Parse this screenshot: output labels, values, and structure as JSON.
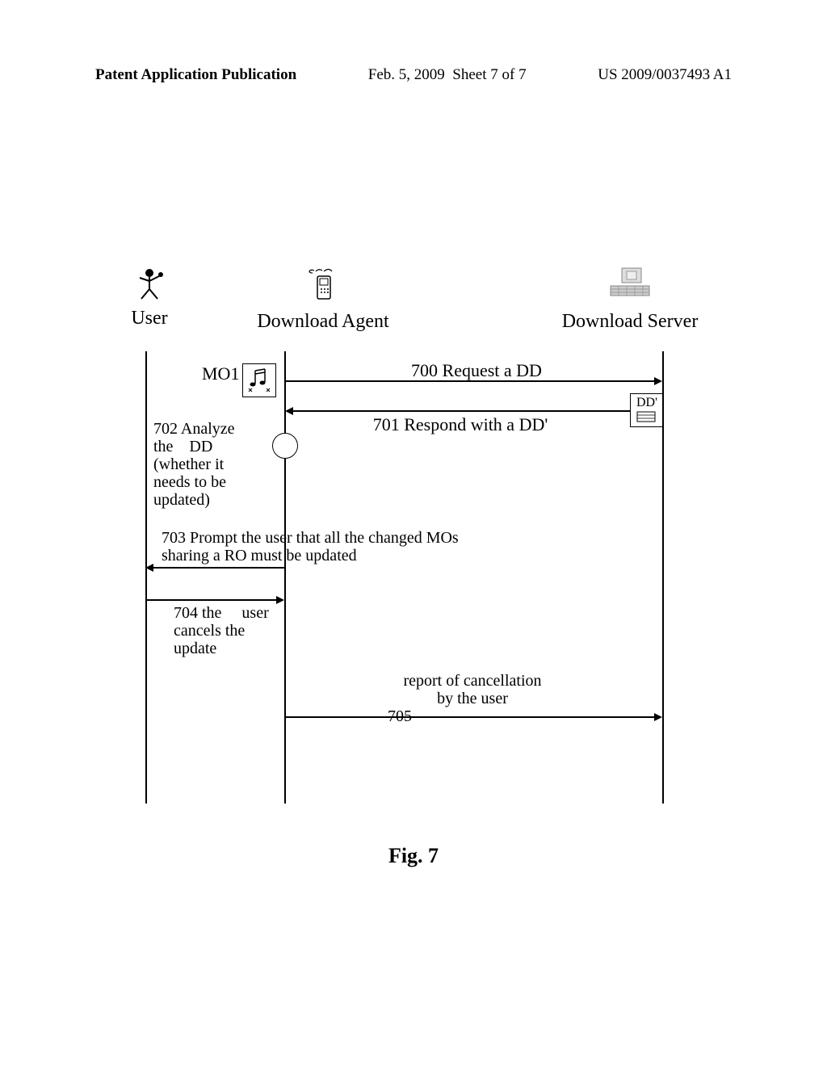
{
  "header": {
    "left": "Patent Application Publication",
    "center_date": "Feb. 5, 2009",
    "center_sheet": "Sheet 7 of 7",
    "right": "US 2009/0037493 A1"
  },
  "actors": {
    "user": "User",
    "agent": "Download Agent",
    "server": "Download Server"
  },
  "labels": {
    "mo1": "MO1",
    "dd_prime": "DD'"
  },
  "steps": {
    "s700": "700   Request a DD",
    "s701": "701   Respond with a DD'",
    "s702_num": "702",
    "s702_text": "Analyze\nthe    DD\n(whether it\nneeds to be\nupdated)",
    "s703_num": "703",
    "s703_text": "Prompt the user that all the changed MOs\nsharing a RO must be updated",
    "s704_num": "704",
    "s704_text": "the     user\ncancels the\nupdate",
    "s705_num": "705",
    "s705_text": "report of cancellation\nby the user"
  },
  "caption": "Fig. 7"
}
